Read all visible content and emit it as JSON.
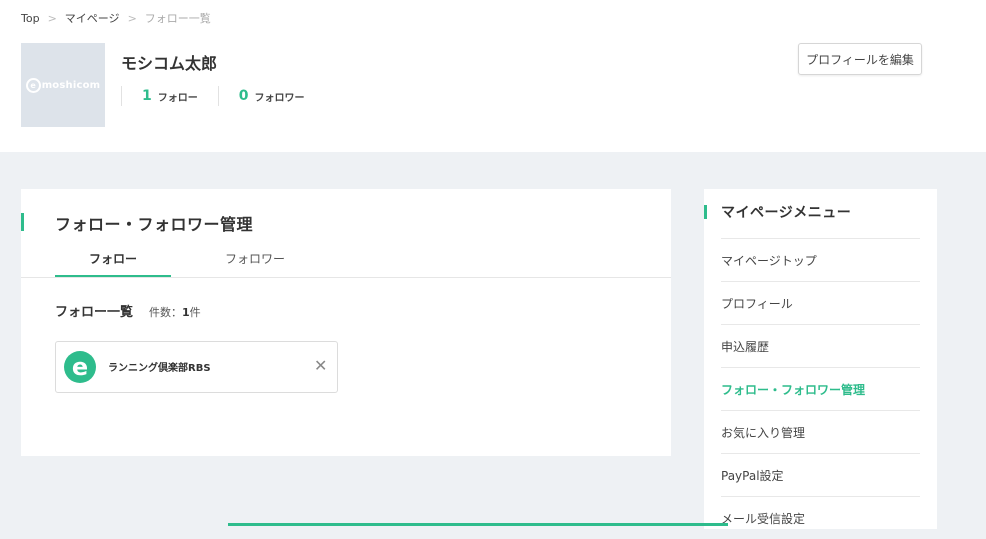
{
  "breadcrumb": [
    "Top",
    "マイページ",
    "フォロー一覧"
  ],
  "breadcrumb_sep": ">",
  "profile": {
    "avatar_logo": "moshicom",
    "avatar_logo_mark": "e",
    "name": "モシコム太郎",
    "follow_count": "1",
    "follow_label": "フォロー",
    "follower_count": "0",
    "follower_label": "フォロワー",
    "edit_button": "プロフィールを編集"
  },
  "main": {
    "title": "フォロー・フォロワー管理",
    "tabs": [
      {
        "label": "フォロー",
        "active": true
      },
      {
        "label": "フォロワー",
        "active": false
      }
    ],
    "list_heading": "フォロー一覧",
    "count_label": "件数：",
    "count_value": "1",
    "count_unit": "件",
    "items": [
      {
        "icon": "e",
        "name": "ランニング倶楽部RBS",
        "remove": "✕"
      }
    ]
  },
  "sidebar": {
    "title": "マイページメニュー",
    "items": [
      {
        "label": "マイページトップ",
        "active": false
      },
      {
        "label": "プロフィール",
        "active": false
      },
      {
        "label": "申込履歴",
        "active": false
      },
      {
        "label": "フォロー・フォロワー管理",
        "active": true
      },
      {
        "label": "お気に入り管理",
        "active": false
      },
      {
        "label": "PayPal設定",
        "active": false
      },
      {
        "label": "メール受信設定",
        "active": false
      }
    ]
  },
  "colors": {
    "accent": "#2ebc8c",
    "page_bg": "#eef1f4",
    "avatar_bg": "#dde3ea"
  }
}
